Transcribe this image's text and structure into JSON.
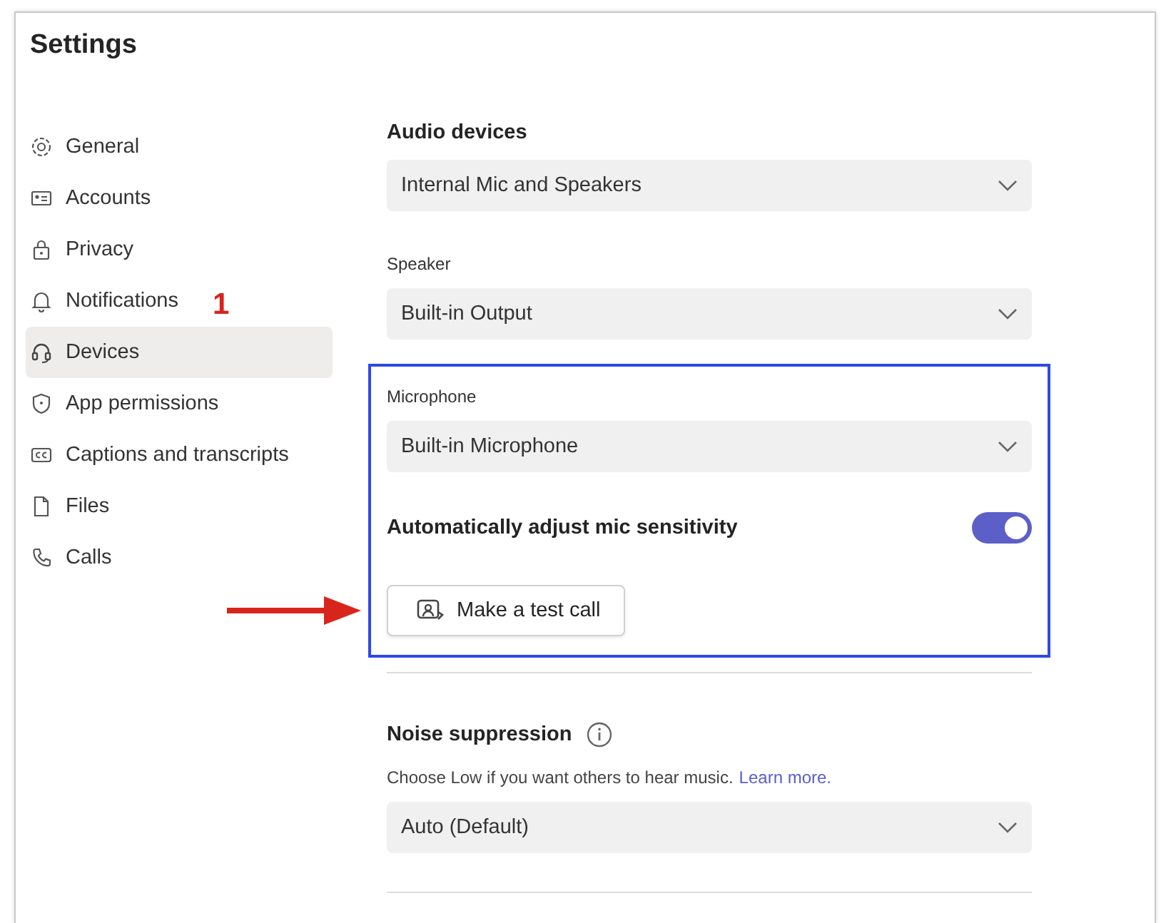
{
  "window": {
    "title": "Settings"
  },
  "sidebar": {
    "items": [
      {
        "label": "General",
        "selected": false
      },
      {
        "label": "Accounts",
        "selected": false
      },
      {
        "label": "Privacy",
        "selected": false
      },
      {
        "label": "Notifications",
        "selected": false
      },
      {
        "label": "Devices",
        "selected": true
      },
      {
        "label": "App permissions",
        "selected": false
      },
      {
        "label": "Captions and transcripts",
        "selected": false
      },
      {
        "label": "Files",
        "selected": false
      },
      {
        "label": "Calls",
        "selected": false
      }
    ]
  },
  "annotation": {
    "label": "1"
  },
  "content": {
    "audio_devices": {
      "heading": "Audio devices",
      "value": "Internal Mic and Speakers"
    },
    "speaker": {
      "label": "Speaker",
      "value": "Built-in Output"
    },
    "microphone": {
      "label": "Microphone",
      "value": "Built-in Microphone"
    },
    "auto_adjust": {
      "label": "Automatically adjust mic sensitivity",
      "on": true
    },
    "test_call_button": {
      "label": "Make a test call"
    },
    "noise_suppression": {
      "heading": "Noise suppression",
      "hint": "Choose Low if you want others to hear music.",
      "link": "Learn more.",
      "value": "Auto (Default)"
    }
  }
}
